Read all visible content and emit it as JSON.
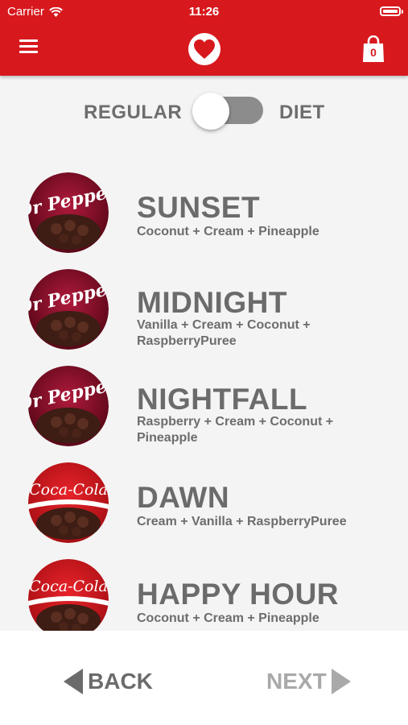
{
  "status_bar": {
    "carrier": "Carrier",
    "time": "11:26"
  },
  "header": {
    "cart_count": "0",
    "menu_icon": "hamburger-icon",
    "logo_icon": "heart-icon",
    "cart_icon": "shopping-bag-icon",
    "brand_color": "#d7191e"
  },
  "toggle": {
    "left_label": "REGULAR",
    "right_label": "DIET",
    "selected": "REGULAR"
  },
  "flavors": [
    {
      "name": "SUNSET",
      "ingredients": "Coconut + Cream + Pineapple",
      "brand": "Dr Pepper",
      "brand_label": "Dr Pepper"
    },
    {
      "name": "MIDNIGHT",
      "ingredients": "Vanilla + Cream + Coconut + RaspberryPuree",
      "brand": "Dr Pepper",
      "brand_label": "Dr Pepper"
    },
    {
      "name": "NIGHTFALL",
      "ingredients": "Raspberry + Cream + Coconut + Pineapple",
      "brand": "Dr Pepper",
      "brand_label": "Dr Pepper"
    },
    {
      "name": "DAWN",
      "ingredients": "Cream + Vanilla + RaspberryPuree",
      "brand": "Coca-Cola",
      "brand_label": "Coca-Cola"
    },
    {
      "name": "HAPPY HOUR",
      "ingredients": "Coconut + Cream + Pineapple",
      "brand": "Coca-Cola",
      "brand_label": "Coca-Cola"
    }
  ],
  "footer": {
    "back_label": "BACK",
    "next_label": "NEXT",
    "back_color": "#6b6b6b",
    "next_color": "#a9a9a9"
  }
}
